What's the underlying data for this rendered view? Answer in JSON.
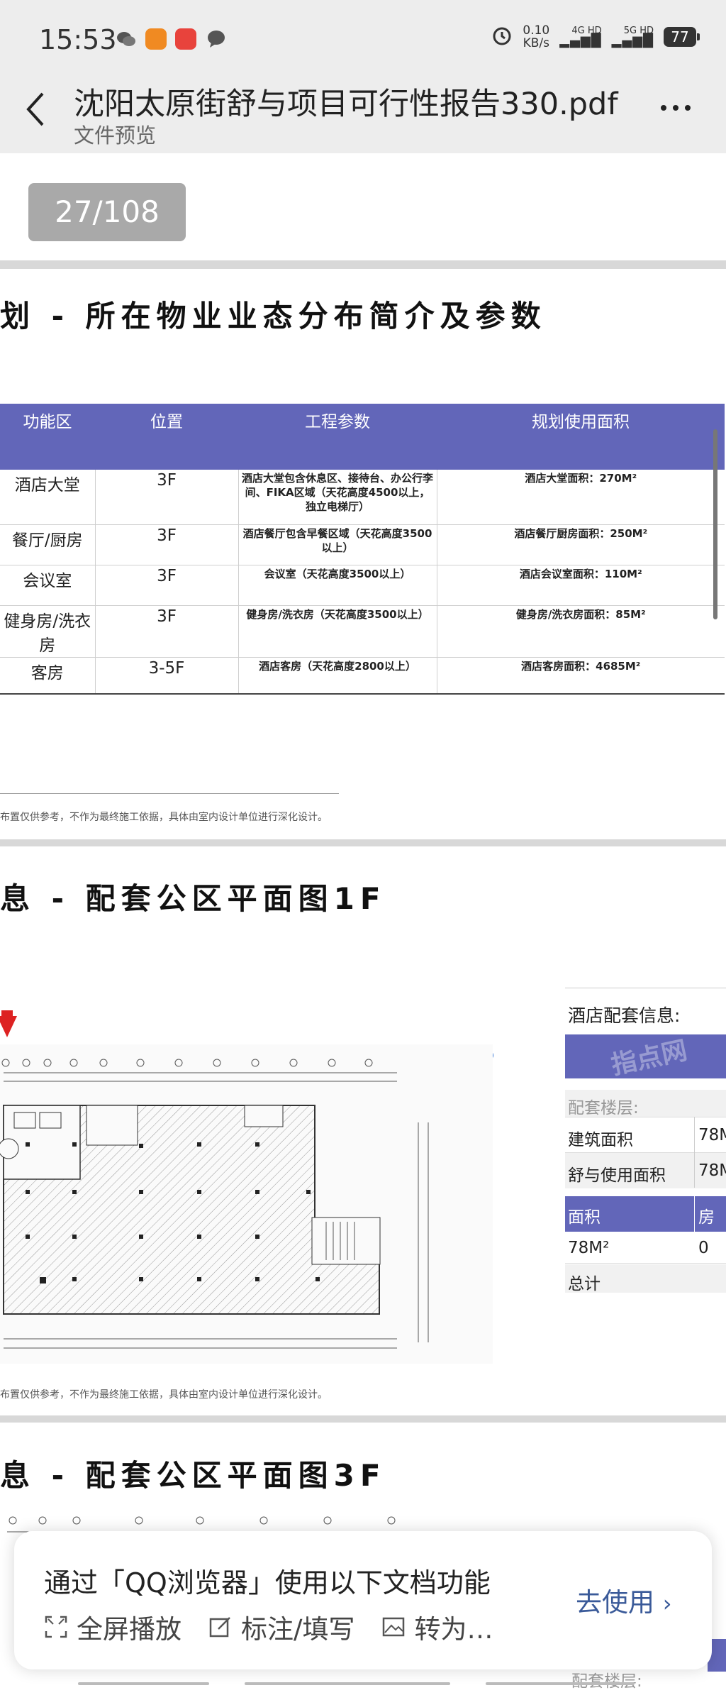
{
  "status_bar": {
    "time": "15:53",
    "net_speed_value": "0.10",
    "net_speed_unit": "KB/s",
    "signal1": "4G HD",
    "signal2": "5G HD",
    "battery": "77"
  },
  "app_bar": {
    "title": "沈阳太原街舒与项目可行性报告330.pdf",
    "subtitle": "文件预览"
  },
  "page_counter": "27/108",
  "page1": {
    "heading": "划 - 所在物业业态分布简介及参数",
    "table": {
      "headers": [
        "功能区",
        "位置",
        "工程参数",
        "规划使用面积"
      ],
      "rows": [
        {
          "area": "酒店大堂",
          "floor": "3F",
          "params": "酒店大堂包含休息区、接待台、办公行李间、FIKA区域（天花高度4500以上，独立电梯厅）",
          "size": "酒店大堂面积：270M²"
        },
        {
          "area": "餐厅/厨房",
          "floor": "3F",
          "params": "酒店餐厅包含早餐区域（天花高度3500以上）",
          "size": "酒店餐厅厨房面积：250M²"
        },
        {
          "area": "会议室",
          "floor": "3F",
          "params": "会议室（天花高度3500以上）",
          "size": "酒店会议室面积：110M²"
        },
        {
          "area": "健身房/洗衣房",
          "floor": "3F",
          "params": "健身房/洗衣房（天花高度3500以上）",
          "size": "健身房/洗衣房面积：85M²"
        },
        {
          "area": "客房",
          "floor": "3-5F",
          "params": "酒店客房（天花高度2800以上）",
          "size": "酒店客房面积：4685M²"
        }
      ]
    },
    "note": "布置仅供参考，不作为最终施工依据，具体由室内设计单位进行深化设计。"
  },
  "page2": {
    "heading": "息 - 配套公区平面图1F",
    "note": "布置仅供参考，不作为最终施工依据，具体由室内设计单位进行深化设计。",
    "info_panel": {
      "label": "酒店配套信息:",
      "floor_label": "配套楼层:",
      "rows": [
        {
          "k": "建筑面积",
          "v": "78M"
        },
        {
          "k": "舒与使用面积",
          "v": "78M"
        }
      ],
      "table_headers": [
        "面积",
        "房量"
      ],
      "table_row": [
        "78M²",
        "0"
      ],
      "total_label": "总计"
    },
    "watermark": "指点网"
  },
  "page3": {
    "heading": "息 - 配套公区平面图3F",
    "floor_label": "配套楼层:"
  },
  "banner": {
    "title": "通过「QQ浏览器」使用以下文档功能",
    "go_label": "去使用",
    "actions": [
      "全屏播放",
      "标注/填写",
      "转为…"
    ]
  },
  "colors": {
    "table_header": "#6266b9",
    "status_bar_bg": "#ededed",
    "banner_link": "#3a5a99",
    "arrow_red": "#d22222"
  }
}
